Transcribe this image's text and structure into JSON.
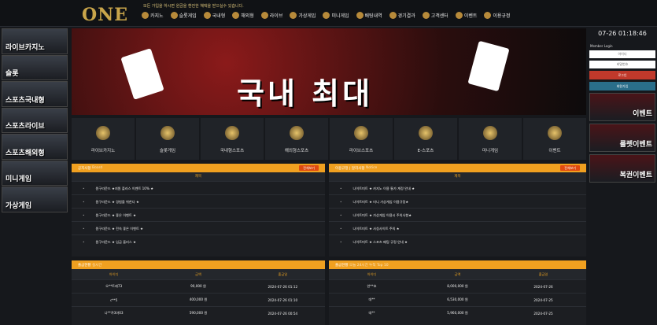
{
  "logo": "ONE",
  "marquee": "모든 가입을 하시면 원금을 환전한 혜택을 받으실수 있습니다.",
  "nav": [
    "카지노",
    "슬롯게임",
    "국내형",
    "해외형",
    "라이브",
    "가상게임",
    "미니게임",
    "배팅내역",
    "경기결과",
    "고객센터",
    "이벤트",
    "이용규정"
  ],
  "left": [
    "라이브카지노",
    "슬롯",
    "스포츠국내형",
    "스포츠라이브",
    "스포츠해외형",
    "미니게임",
    "가상게임"
  ],
  "banner": "국내 최대",
  "games": [
    "라이브카지노",
    "슬롯게임",
    "국내형스포츠",
    "해외형스포츠",
    "라이브스포츠",
    "E-스포츠",
    "미니게임",
    "이벤트"
  ],
  "notice": {
    "title": "공지사항",
    "sub": "Board",
    "more": "전체보기",
    "col": "제목",
    "rows": [
      "원구라운드 ★지원 플러스 이벤트 10% ★",
      "원구라운드 ★ 경험을 위한다 ★",
      "원구라운드 ★ 좋은 이벤트 ★",
      "원구라운드 ★ 전속 좋은 이벤트 ★",
      "원구라운드 ★ 입금 플러스 ★"
    ]
  },
  "event": {
    "title": "이용규정 | 알리사항",
    "sub": "Notice",
    "more": "전체보기",
    "col": "제목",
    "rows": [
      "나이트미트 ★ 카지노 이용 통가 계정 안내 ★",
      "나이트미트 ★ 미니 가상게임 이용규정★",
      "나이트미트 ★ 가상게임 이용시 주의사항★",
      "나이트미트 ★ 사칭사이트 주의 ★",
      "나이트미트 ★ 스포츠 베팅 규정 안내 ★"
    ]
  },
  "withdraw": {
    "title": "출금현황",
    "sub": "실시간",
    "cols": [
      "아이디",
      "금액",
      "출금일"
    ],
    "rows": [
      [
        "오**트레73",
        "90,000 원",
        "2024-07-26 01:12"
      ],
      [
        "c**5",
        "400,000 원",
        "2024-07-26 01:10"
      ],
      [
        "나**캬3야03",
        "590,000 원",
        "2024-07-26 00:54"
      ]
    ]
  },
  "ranking": {
    "title": "출금현황",
    "sub": "오늘 24시간 누적 Top 10",
    "cols": [
      "아이디",
      "금액",
      "출금일"
    ],
    "rows": [
      [
        "안**호",
        "8,000,000 원",
        "2024-07-26"
      ],
      [
        "대**",
        "6,530,000 원",
        "2024-07-25"
      ],
      [
        "대**",
        "5,960,000 원",
        "2024-07-25"
      ]
    ]
  },
  "right": {
    "clock": "07-26 01:18:46",
    "member": "Member Login",
    "id": "아이디",
    "pw": "비밀번호",
    "login": "로그인",
    "join": "회원가입",
    "banners": [
      "이벤트",
      "룰렛이벤트",
      "복권이벤트"
    ]
  },
  "colors": {
    "accent": "#f0a020",
    "login": "#c0392b",
    "join": "#2a6e8a"
  }
}
